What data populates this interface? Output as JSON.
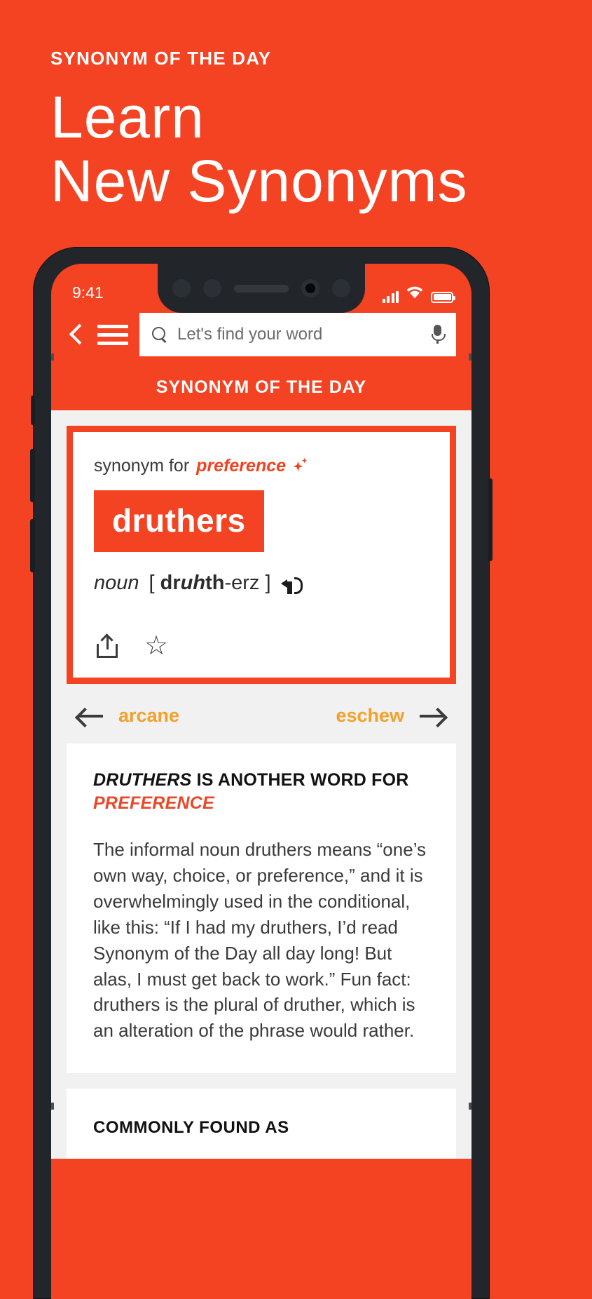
{
  "promo": {
    "kicker": "SYNONYM OF THE DAY",
    "title_line1": "Learn",
    "title_line2": "New Synonyms"
  },
  "phone": {
    "status": {
      "time": "9:41",
      "signal_icon": "cellular-signal-icon",
      "wifi_icon": "wifi-icon",
      "battery_icon": "battery-full-icon"
    },
    "header": {
      "back_icon": "chevron-left-icon",
      "menu_icon": "hamburger-menu-icon",
      "search_icon": "search-icon",
      "search_placeholder": "Let's find your word",
      "search_value": "",
      "mic_icon": "microphone-icon",
      "subtitle": "SYNONYM OF THE DAY"
    },
    "word_card": {
      "synonym_for_label": "synonym for",
      "synonym_for_word": "preference",
      "sparkle_icon": "sparkle-icon",
      "word": "druthers",
      "part_of_speech": "noun",
      "pron_open": "[",
      "pron_pre": "dr",
      "pron_stress": "uh",
      "pron_post": "th",
      "pron_tail": "-erz",
      "pron_close": "]",
      "speaker_icon": "speaker-icon",
      "share_icon": "share-icon",
      "star_icon": "star-outline-icon"
    },
    "word_nav": {
      "prev_label": "arcane",
      "prev_icon": "arrow-left-icon",
      "next_label": "eschew",
      "next_icon": "arrow-right-icon"
    },
    "info_card": {
      "head_word": "DRUTHERS",
      "head_mid": " IS ANOTHER WORD FOR",
      "head_target": "PREFERENCE",
      "body": "The informal noun druthers means “one’s own way, choice, or preference,” and it is overwhelmingly used in the conditional, like this: “If I had my druthers, I’d read Synonym of the Day all day long! But alas, I must get back to work.” Fun fact: druthers is the plural of druther, which is an alteration of the phrase would rather."
    },
    "bottom_section": {
      "title": "COMMONLY FOUND AS"
    }
  },
  "colors": {
    "brand_orange": "#F44323",
    "accent_amber": "#F2A12A",
    "screen_bg": "#f1f1f1"
  }
}
